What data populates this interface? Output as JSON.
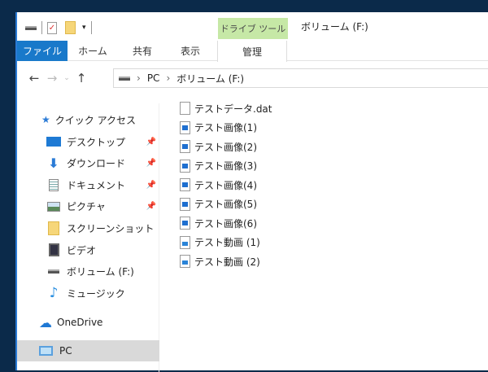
{
  "window": {
    "title": "ボリューム (F:)",
    "context_tab": "ドライブ ツール"
  },
  "ribbon": {
    "tabs": [
      "ファイル",
      "ホーム",
      "共有",
      "表示"
    ],
    "context_tab_label": "管理"
  },
  "address": {
    "segments": [
      "PC",
      "ボリューム (F:)"
    ]
  },
  "sidebar": {
    "quick_access": "クイック アクセス",
    "items": [
      {
        "label": "デスクトップ",
        "icon": "desktop-icon",
        "pinned": true
      },
      {
        "label": "ダウンロード",
        "icon": "download-icon",
        "pinned": true
      },
      {
        "label": "ドキュメント",
        "icon": "document-icon",
        "pinned": true
      },
      {
        "label": "ピクチャ",
        "icon": "picture-icon",
        "pinned": true
      },
      {
        "label": "スクリーンショット",
        "icon": "folder-icon",
        "pinned": false
      },
      {
        "label": "ビデオ",
        "icon": "video-icon",
        "pinned": false
      },
      {
        "label": "ボリューム (F:)",
        "icon": "drive-icon",
        "pinned": false
      },
      {
        "label": "ミュージック",
        "icon": "music-icon",
        "pinned": false
      }
    ],
    "onedrive": "OneDrive",
    "pc": "PC"
  },
  "files": [
    {
      "name": "テストデータ.dat",
      "type": "file"
    },
    {
      "name": "テスト画像(1)",
      "type": "img"
    },
    {
      "name": "テスト画像(2)",
      "type": "img"
    },
    {
      "name": "テスト画像(3)",
      "type": "img"
    },
    {
      "name": "テスト画像(4)",
      "type": "img"
    },
    {
      "name": "テスト画像(5)",
      "type": "img"
    },
    {
      "name": "テスト画像(6)",
      "type": "img"
    },
    {
      "name": "テスト動画 (1)",
      "type": "vid"
    },
    {
      "name": "テスト動画 (2)",
      "type": "vid"
    }
  ]
}
